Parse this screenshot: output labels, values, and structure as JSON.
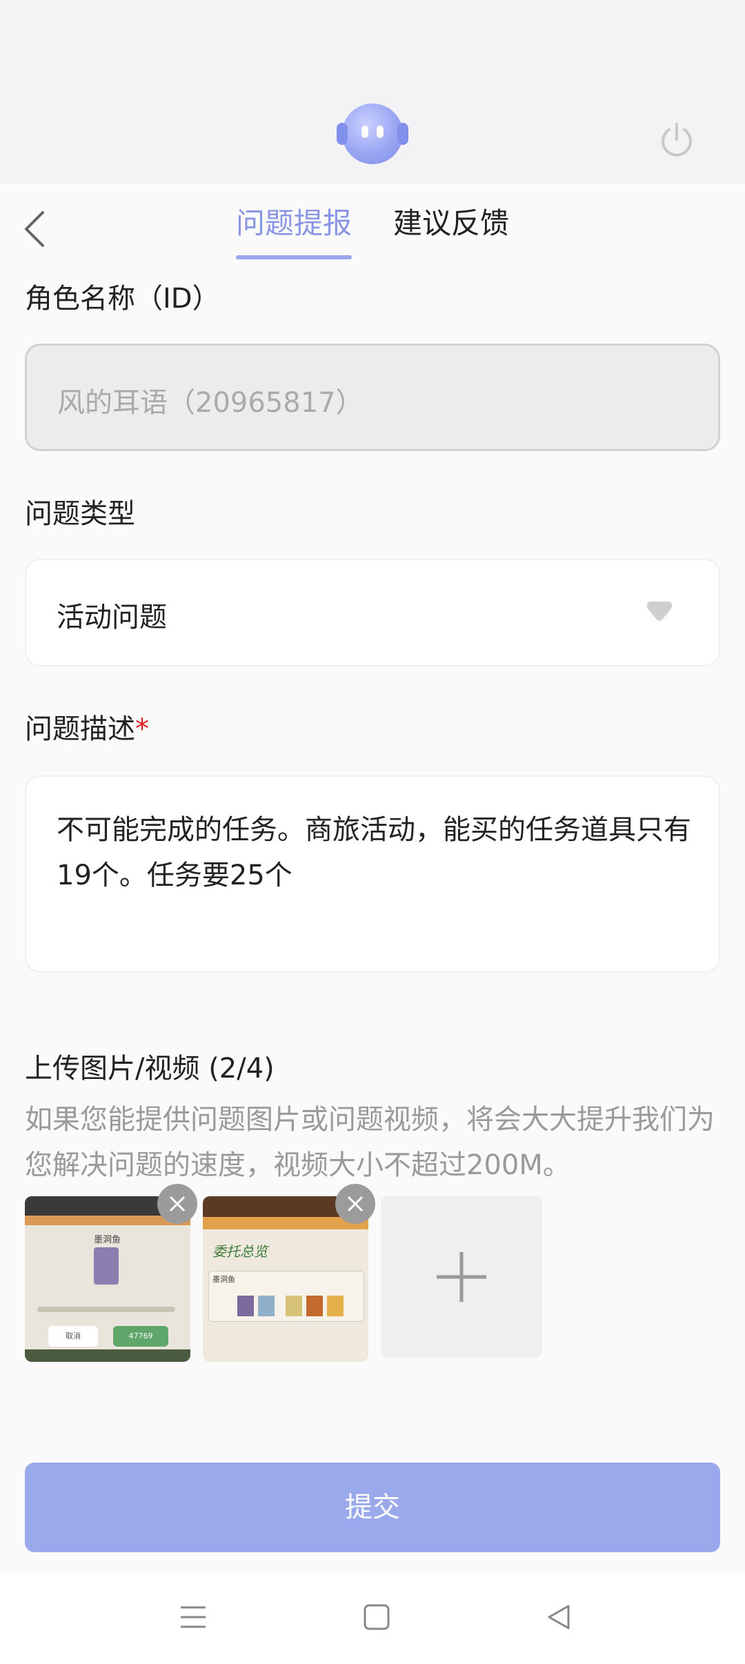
{
  "tabs": {
    "report": "问题提报",
    "suggest": "建议反馈"
  },
  "form": {
    "role_label": "角色名称（ID）",
    "role_value": "风的耳语（20965817）",
    "type_label": "问题类型",
    "type_value": "活动问题",
    "desc_label": "问题描述",
    "desc_required_mark": "*",
    "desc_value": "不可能完成的任务。商旅活动，能买的任务道具只有19个。任务要25个",
    "upload_label": "上传图片/视频 (2/4)",
    "upload_hint": "如果您能提供问题图片或问题视频，将会大大提升我们为您解决问题的速度，视频大小不超过200M。"
  },
  "thumbs": [
    {
      "icon": "game-screenshot-image",
      "title": "墨洞鱼",
      "cancel": "取消",
      "count": "47769"
    },
    {
      "icon": "game-screenshot-image",
      "title": "委托总览",
      "item": "墨洞鱼"
    }
  ],
  "submit_label": "提交",
  "colors": {
    "accent": "#8a96e4",
    "submit_bg": "#9aa8ec",
    "required": "#e02020"
  }
}
